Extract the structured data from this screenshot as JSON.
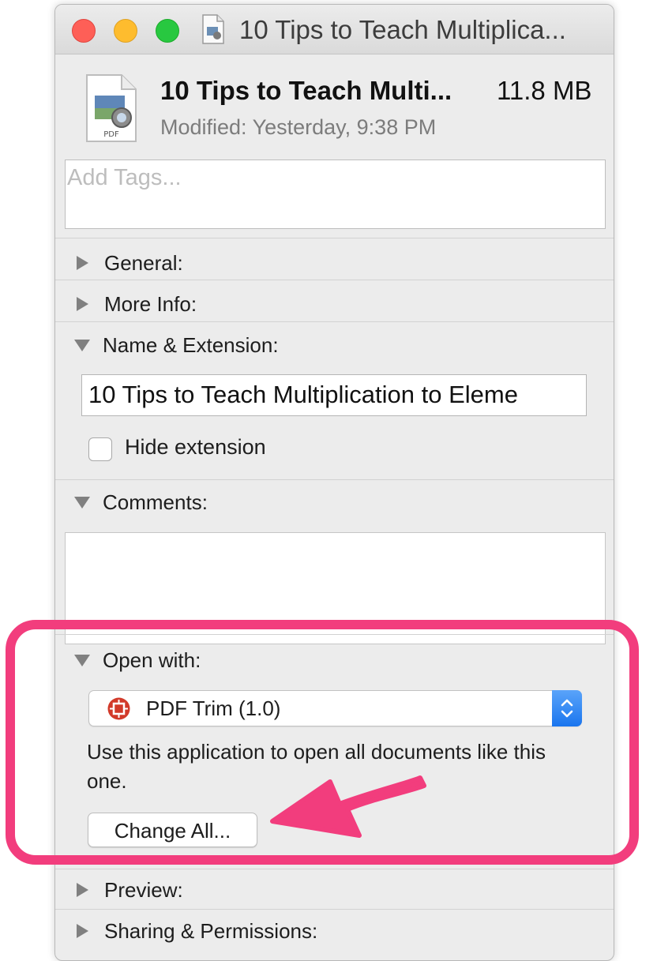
{
  "window": {
    "title": "10 Tips to Teach Multiplica...",
    "traffic_lights": {
      "close_color": "#fe5f57",
      "minimize_color": "#febc2e",
      "zoom_color": "#28c840"
    }
  },
  "file": {
    "name": "10 Tips to Teach Multi...",
    "size": "11.8 MB",
    "modified": "Modified:  Yesterday, 9:38 PM",
    "icon": "pdf-document-icon",
    "icon_label": "PDF"
  },
  "tags": {
    "placeholder": "Add Tags..."
  },
  "sections": {
    "general": {
      "label": "General:",
      "expanded": false
    },
    "more_info": {
      "label": "More Info:",
      "expanded": false
    },
    "name_extension": {
      "label": "Name & Extension:",
      "expanded": true,
      "filename_value": "10 Tips to Teach Multiplication to Eleme",
      "hide_extension_label": "Hide extension",
      "hide_extension_checked": false
    },
    "comments": {
      "label": "Comments:",
      "expanded": true,
      "value": ""
    },
    "open_with": {
      "label": "Open with:",
      "expanded": true,
      "selected_app": "PDF Trim (1.0)",
      "app_icon": "pdf-trim-app-icon",
      "description": "Use this application to open all documents like this one.",
      "change_all_label": "Change All..."
    },
    "preview": {
      "label": "Preview:",
      "expanded": false
    },
    "sharing": {
      "label": "Sharing & Permissions:",
      "expanded": false
    }
  },
  "annotation": {
    "highlight_color": "#f23d7d",
    "target": "change-all-button"
  }
}
